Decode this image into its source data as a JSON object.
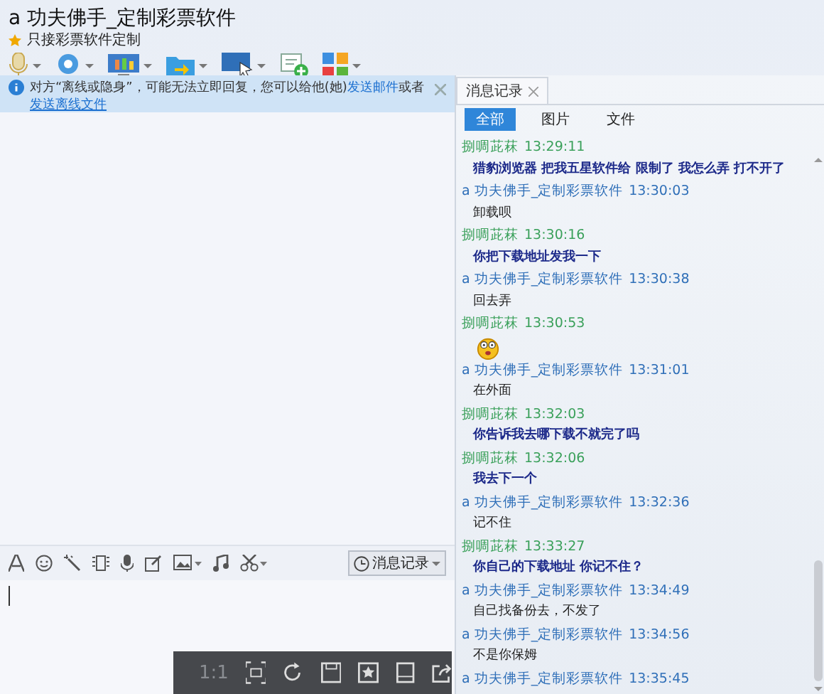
{
  "window": {
    "title": "a 功夫佛手_定制彩票软件",
    "signature": "只接彩票软件定制"
  },
  "notice": {
    "text": "对方“离线或隐身”，可能无法立即回复，您可以给他(她)",
    "link_1": "发送邮件",
    "connector": "或者",
    "link_2": "发送离线文件"
  },
  "history_panel": {
    "tab": "消息记录",
    "filters": [
      {
        "label": "全部",
        "selected": true
      },
      {
        "label": "图片",
        "selected": false
      },
      {
        "label": "文件",
        "selected": false
      }
    ],
    "messages": [
      {
        "kind": "received",
        "sender": "捌啁茈菻",
        "time": "13:29:11",
        "text": "猎豹浏览器 把我五星软件给 限制了 我怎么弄 打不开了"
      },
      {
        "kind": "sent",
        "sender": "a 功夫佛手_定制彩票软件",
        "time": "13:30:03",
        "text": "卸载呗"
      },
      {
        "kind": "received",
        "sender": "捌啁茈菻",
        "time": "13:30:16",
        "text": "你把下载地址发我一下"
      },
      {
        "kind": "sent",
        "sender": "a 功夫佛手_定制彩票软件",
        "time": "13:30:38",
        "text": "回去弄"
      },
      {
        "kind": "received_emoji",
        "sender": "捌啁茈菻",
        "time": "13:30:53"
      },
      {
        "kind": "sent",
        "sender": "a 功夫佛手_定制彩票软件",
        "time": "13:31:01",
        "text": "在外面"
      },
      {
        "kind": "received",
        "sender": "捌啁茈菻",
        "time": "13:32:03",
        "text": "你告诉我去哪下载不就完了吗"
      },
      {
        "kind": "received",
        "sender": "捌啁茈菻",
        "time": "13:32:06",
        "text": "我去下一个"
      },
      {
        "kind": "sent",
        "sender": "a 功夫佛手_定制彩票软件",
        "time": "13:32:36",
        "text": "记不住"
      },
      {
        "kind": "received",
        "sender": "捌啁茈菻",
        "time": "13:33:27",
        "text": "你自己的下载地址  你记不住？"
      },
      {
        "kind": "sent",
        "sender": "a 功夫佛手_定制彩票软件",
        "time": "13:34:49",
        "text": "自己找备份去，不发了"
      },
      {
        "kind": "sent",
        "sender": "a 功夫佛手_定制彩票软件",
        "time": "13:34:56",
        "text": "不是你保姆"
      },
      {
        "kind": "sent",
        "sender": "a 功夫佛手_定制彩票软件",
        "time": "13:35:45"
      }
    ]
  },
  "input": {
    "history_button": "消息记录"
  },
  "image_viewer_bar": {
    "zoom_label": "1:1"
  }
}
